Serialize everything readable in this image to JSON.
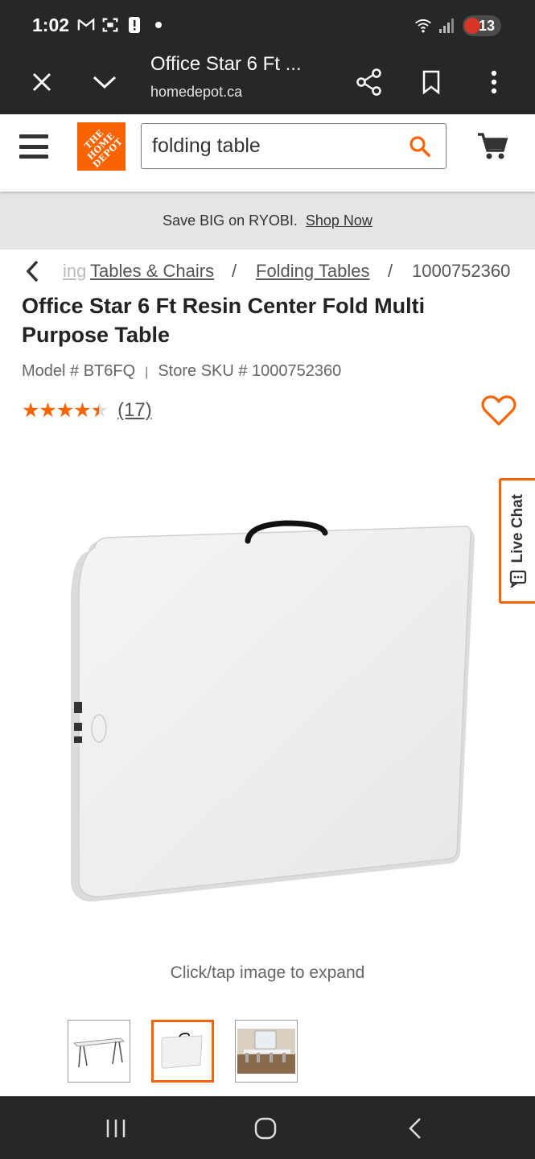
{
  "status_bar": {
    "time": "1:02",
    "battery": "13",
    "icons": [
      "gmail-icon",
      "screenshot-icon",
      "alert-icon",
      "dot-icon",
      "wifi-icon",
      "signal-icon"
    ]
  },
  "browser": {
    "page_title": "Office Star 6 Ft ...",
    "url": "homedepot.ca"
  },
  "header": {
    "logo_text": "THE HOME DEPOT",
    "search_value": "folding table"
  },
  "promo": {
    "text": "Save BIG on RYOBI.",
    "link": "Shop Now"
  },
  "breadcrumb": {
    "faded": "ing",
    "items": [
      "Tables & Chairs",
      "Folding Tables"
    ],
    "separator": "/",
    "current": "1000752360"
  },
  "product": {
    "brand": "Office Star",
    "name": "6 Ft Resin Center Fold Multi Purpose Table",
    "model_label": "Model # BT6FQ",
    "sku_label": "Store SKU # 1000752360",
    "meta_separator": "|",
    "rating": 4.5,
    "review_count": "(17)",
    "stars": "★★★★★"
  },
  "live_chat": "Live Chat",
  "expand_hint": "Click/tap image to expand",
  "thumbnails": [
    {
      "name": "table-open-thumbnail",
      "active": false
    },
    {
      "name": "table-folded-thumbnail",
      "active": true
    },
    {
      "name": "table-room-thumbnail",
      "active": false
    }
  ],
  "colors": {
    "brand_orange": "#f96302",
    "bar_dark": "#262728"
  }
}
